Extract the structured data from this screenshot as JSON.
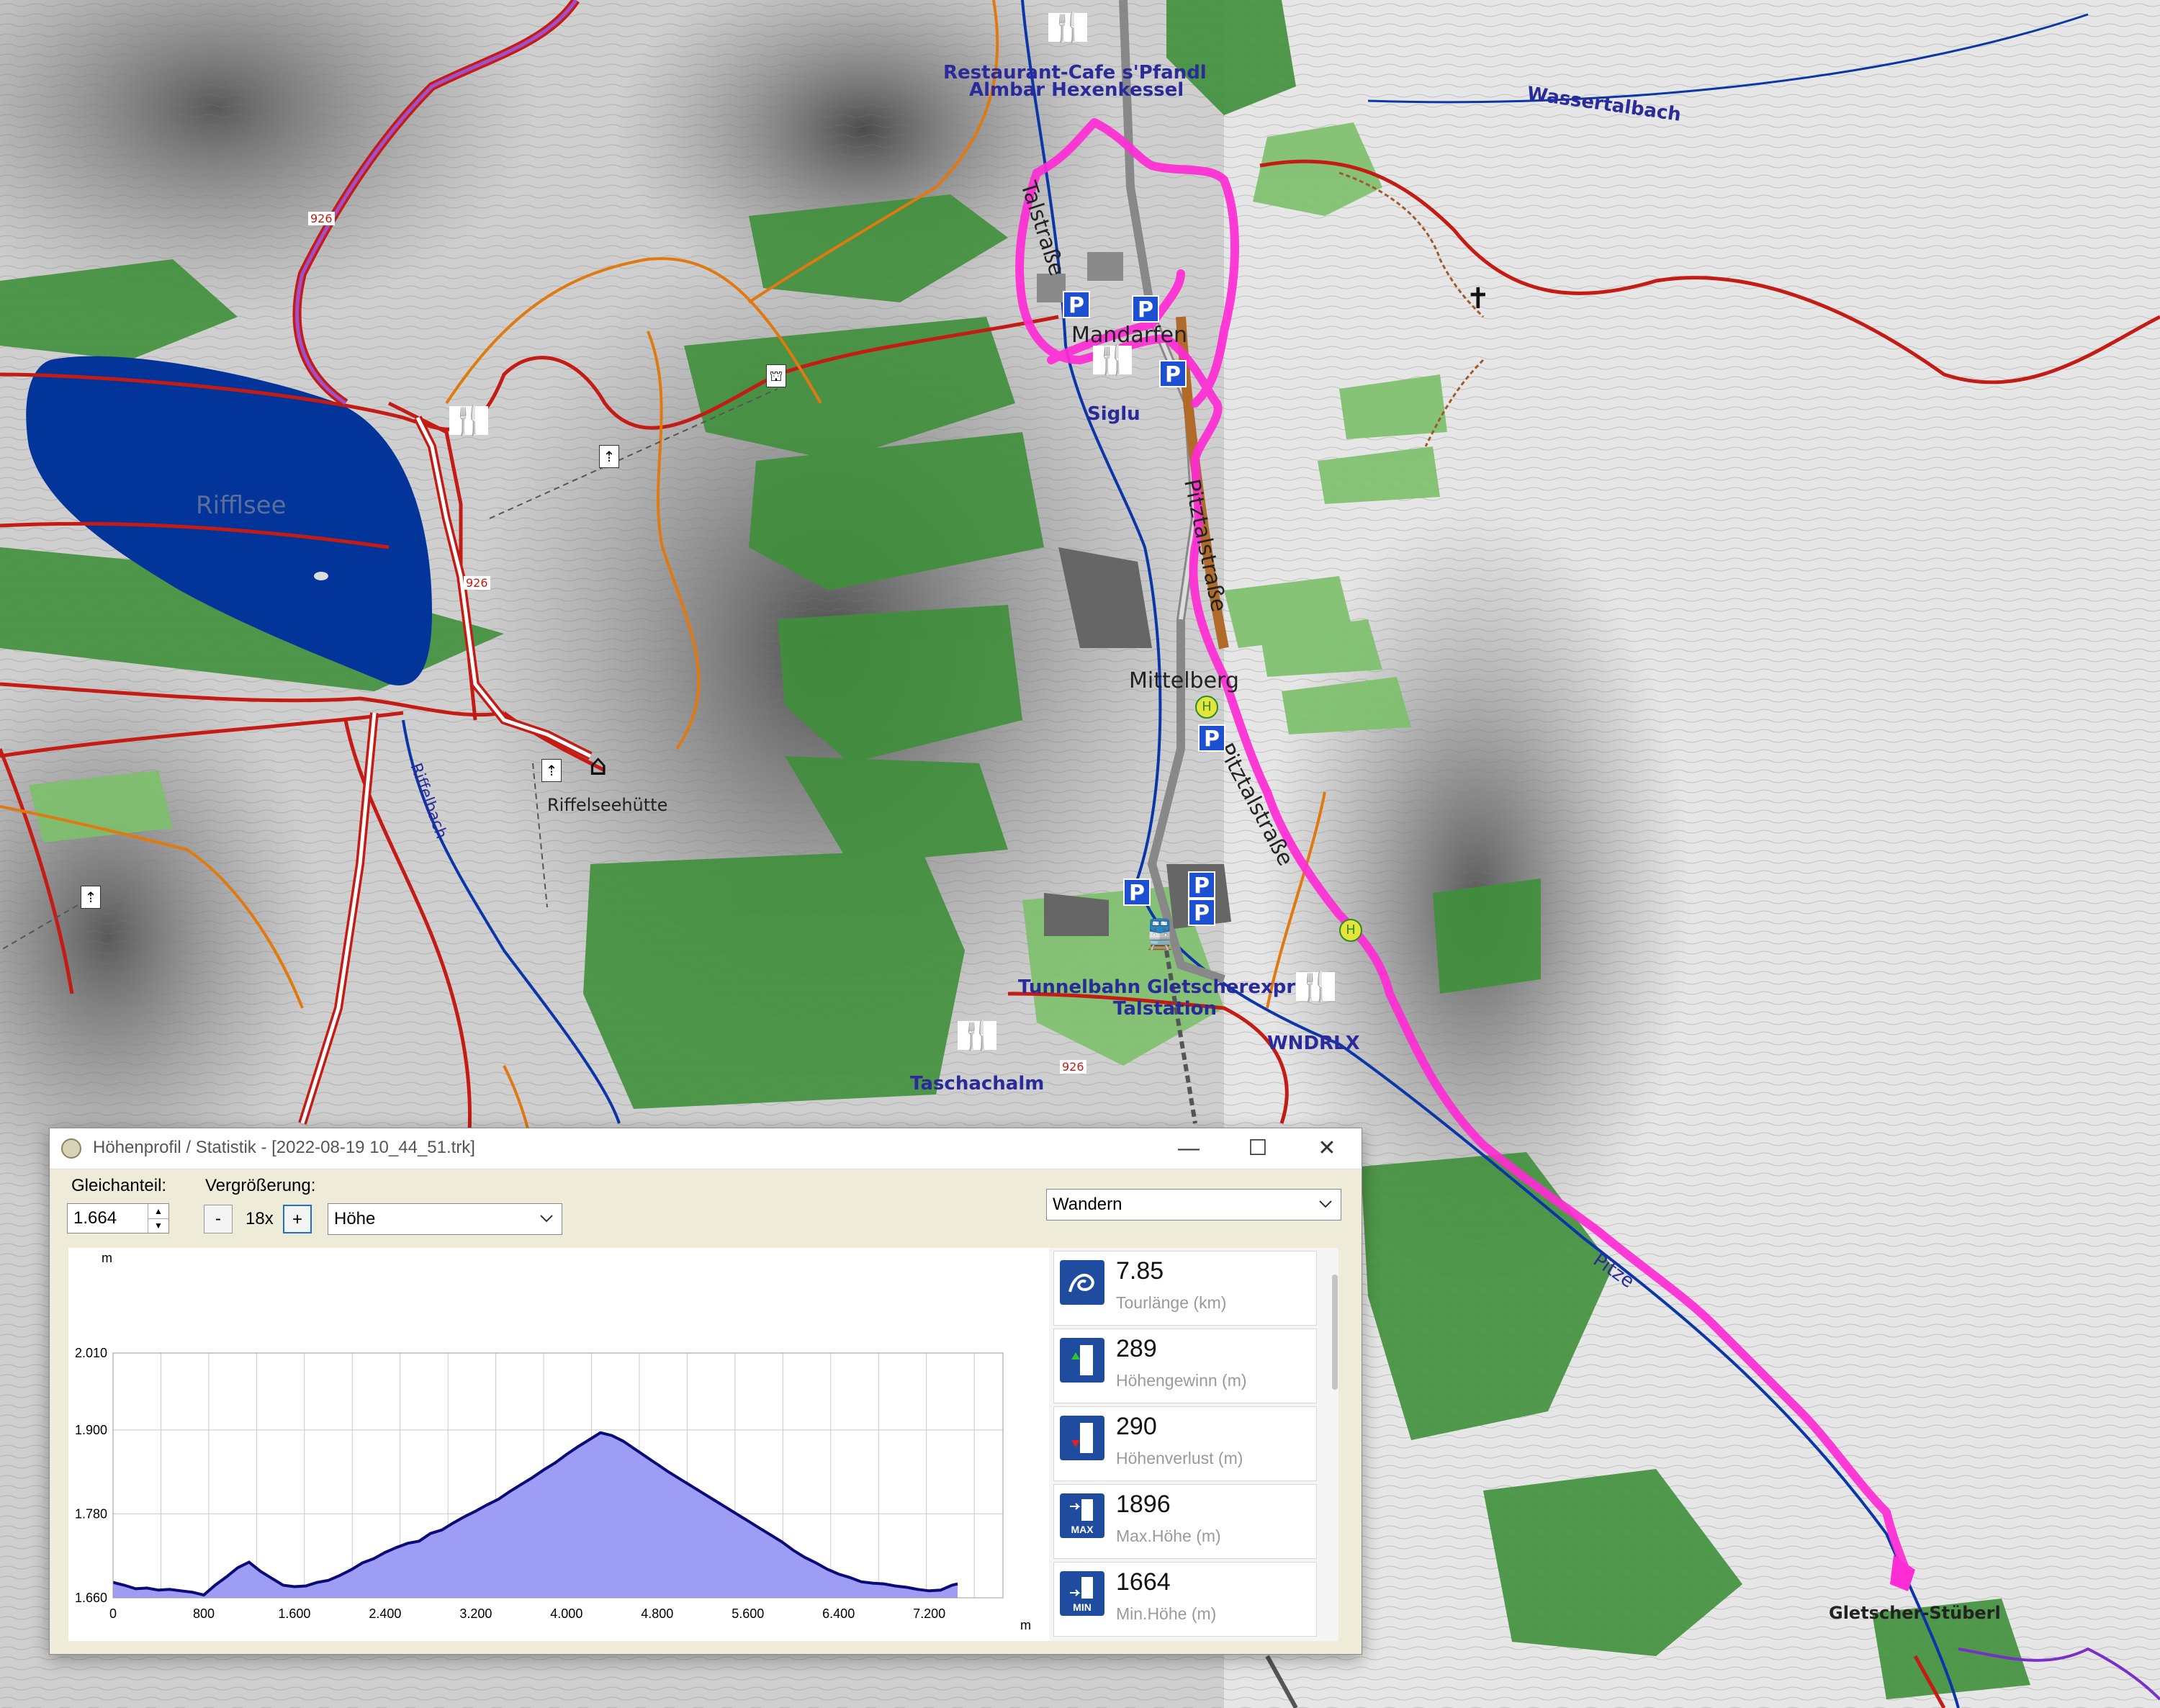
{
  "map": {
    "labels": {
      "restaurant": "Restaurant-Cafe s'Pfandl",
      "almbar": "Almbar Hexenkessel",
      "wassertalbach": "Wassertalbach",
      "talstrasse": "Talstraße",
      "mandarfen": "Mandarfen",
      "siglu": "Siglu",
      "rifflsee": "Rifflsee",
      "pitztalstrasse": "Pitztalstraße",
      "mittelberg": "Mittelberg",
      "riffelseehuette": "Riffelseehütte",
      "tunnelbahn": "Tunnelbahn Gletscherexpress",
      "talstation": "Talstation",
      "wndrlx": "WNDRLX",
      "taschachalm": "Taschachalm",
      "gletscherstueberl": "Gletscher-Stüberl",
      "pitze": "Pitze",
      "route_926a": "926",
      "route_926b": "926",
      "route_926c": "926",
      "riffelbach": "Riffelbach"
    },
    "colors": {
      "track": "#ff2bd4",
      "water": "#03349a",
      "forest": "#3f8f3a",
      "trail": "#c41b14",
      "orange_trail": "#e07a10"
    }
  },
  "window": {
    "title": "Höhenprofil / Statistik - [2022-08-19 10_44_51.trk]",
    "controls": {
      "minimize": "—",
      "maximize": "☐",
      "close": "✕"
    },
    "toolbar": {
      "gleichanteil_label": "Gleichanteil:",
      "gleichanteil_value": "1.664",
      "vergroesserung_label": "Vergrößerung:",
      "minus": "-",
      "zoom": "18x",
      "plus": "+",
      "profile_select": "Höhe",
      "activity_select": "Wandern"
    },
    "stats": [
      {
        "icon": "hiker-icon",
        "value": "7.85",
        "label": "Tourlänge (km)"
      },
      {
        "icon": "ascent-icon",
        "value": "289",
        "label": "Höhengewinn (m)"
      },
      {
        "icon": "descent-icon",
        "value": "290",
        "label": "Höhenverlust (m)"
      },
      {
        "icon": "max-icon",
        "value": "1896",
        "label": "Max.Höhe (m)"
      },
      {
        "icon": "min-icon",
        "value": "1664",
        "label": "Min.Höhe (m)"
      }
    ],
    "stat_icon_text": {
      "max": "MAX",
      "min": "MIN"
    }
  },
  "chart_data": {
    "type": "area",
    "ylabel": "m",
    "xlabel": "m",
    "ylim": [
      1660,
      2010
    ],
    "xlim": [
      0,
      7850
    ],
    "yticks": [
      "2.010",
      "1.900",
      "1.780",
      "1.660"
    ],
    "ytick_values": [
      2010,
      1900,
      1780,
      1660
    ],
    "xticks": [
      "0",
      "800",
      "1.600",
      "2.400",
      "3.200",
      "4.000",
      "4.800",
      "5.600",
      "6.400",
      "7.200"
    ],
    "xtick_values": [
      0,
      800,
      1600,
      2400,
      3200,
      4000,
      4800,
      5600,
      6400,
      7200
    ],
    "grid": true,
    "fill_color": "#9d9df5",
    "line_color": "#0a0a78",
    "x": [
      0,
      100,
      200,
      300,
      400,
      500,
      600,
      700,
      800,
      900,
      1000,
      1100,
      1200,
      1300,
      1400,
      1500,
      1600,
      1700,
      1800,
      1900,
      2000,
      2100,
      2200,
      2300,
      2400,
      2500,
      2600,
      2700,
      2800,
      2900,
      3000,
      3100,
      3200,
      3300,
      3400,
      3500,
      3600,
      3700,
      3800,
      3900,
      4000,
      4100,
      4200,
      4300,
      4400,
      4500,
      4600,
      4700,
      4800,
      4900,
      5000,
      5100,
      5200,
      5300,
      5400,
      5500,
      5600,
      5700,
      5800,
      5900,
      6000,
      6100,
      6200,
      6300,
      6400,
      6500,
      6600,
      6700,
      6800,
      6900,
      7000,
      7100,
      7200,
      7300,
      7400,
      7450
    ],
    "y": [
      1682,
      1678,
      1673,
      1674,
      1671,
      1672,
      1670,
      1668,
      1664,
      1678,
      1690,
      1703,
      1711,
      1698,
      1688,
      1678,
      1676,
      1677,
      1682,
      1685,
      1692,
      1700,
      1710,
      1716,
      1725,
      1732,
      1738,
      1741,
      1752,
      1757,
      1767,
      1776,
      1784,
      1793,
      1801,
      1812,
      1822,
      1832,
      1843,
      1853,
      1865,
      1876,
      1886,
      1896,
      1892,
      1884,
      1873,
      1862,
      1851,
      1840,
      1830,
      1820,
      1810,
      1800,
      1790,
      1780,
      1770,
      1760,
      1750,
      1740,
      1728,
      1718,
      1710,
      1701,
      1694,
      1689,
      1683,
      1681,
      1680,
      1677,
      1675,
      1672,
      1670,
      1671,
      1678,
      1680
    ]
  }
}
